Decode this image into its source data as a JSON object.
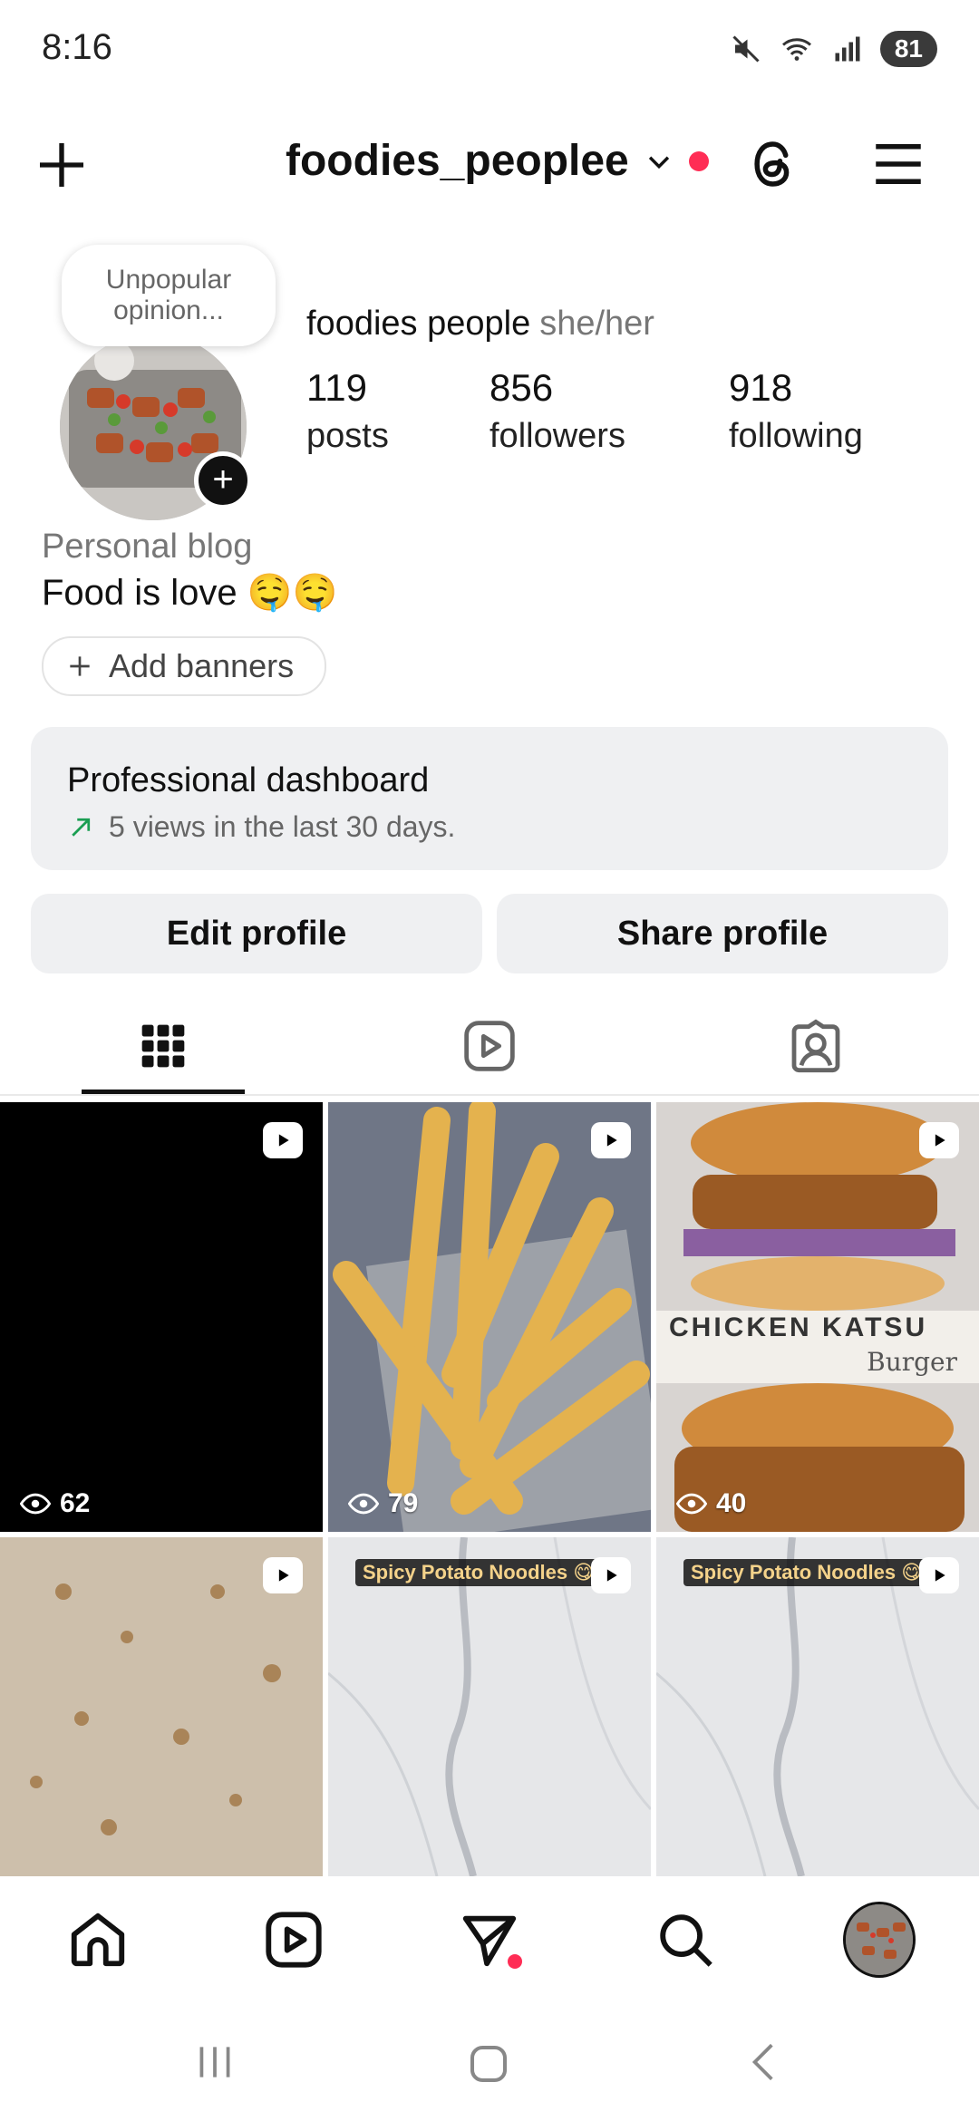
{
  "status_bar": {
    "time": "8:16",
    "battery": "81"
  },
  "header": {
    "username": "foodies_peoplee"
  },
  "note": {
    "text": "Unpopular opinion..."
  },
  "profile": {
    "display_name": "foodies people",
    "pronouns": "she/her",
    "stats": [
      {
        "value": "119",
        "label": "posts"
      },
      {
        "value": "856",
        "label": "followers"
      },
      {
        "value": "918",
        "label": "following"
      }
    ],
    "category": "Personal blog",
    "bio": "Food is love 🤤🤤",
    "add_banners_label": "Add banners"
  },
  "dashboard": {
    "title": "Professional dashboard",
    "subtitle": "5 views in the last 30 days."
  },
  "actions": {
    "edit_label": "Edit profile",
    "share_label": "Share profile"
  },
  "grid": {
    "views": [
      "62",
      "79",
      "40"
    ],
    "captions": [
      "Spicy Potato Noodles 😋",
      "Spicy Potato Noodles 😋"
    ],
    "katsu_title": "CHICKEN KATSU",
    "katsu_sub": "Burger"
  },
  "colors": {
    "accent_red": "#ff2d55",
    "button_bg": "#eff0f2",
    "trend_green": "#1a9e52"
  }
}
